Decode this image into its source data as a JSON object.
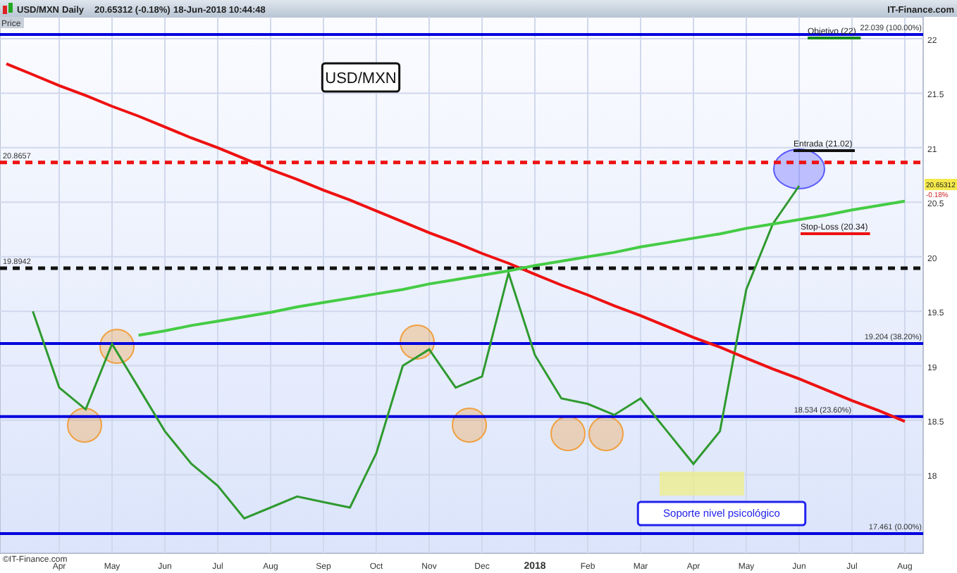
{
  "header": {
    "symbol": "USD/MXN",
    "period": "Daily",
    "quote": "20.65312 (-0.18%)",
    "timestamp": "18-Jun-2018 10:44:48",
    "brand": "IT-Finance.com"
  },
  "price_label": "Price",
  "chart": {
    "chart_data": {
      "type": "line",
      "grid": true,
      "ylim": [
        17.28,
        22.2
      ],
      "categories": [
        null,
        null,
        "Apr",
        null,
        "May",
        null,
        "Jun",
        null,
        "Jul",
        null,
        "Aug",
        null,
        "Sep",
        null,
        "Oct",
        null,
        "Nov",
        null,
        "Dec",
        null,
        "2018",
        null,
        "Feb",
        null,
        "Mar",
        null,
        "Apr",
        null,
        "May",
        null,
        "Jun",
        null,
        "Jul",
        null,
        "Aug"
      ],
      "yticks": [
        18,
        18.5,
        19,
        19.5,
        20,
        20.5,
        21,
        21.5,
        22
      ],
      "series": [
        {
          "color": "#2f9a2f",
          "values": [
            null,
            19.5,
            18.8,
            18.6,
            19.2,
            18.8,
            18.4,
            18.1,
            17.9,
            17.6,
            17.7,
            17.8,
            17.75,
            17.7,
            18.2,
            19.0,
            19.15,
            18.8,
            18.9,
            19.85,
            19.1,
            18.7,
            18.65,
            18.55,
            18.7,
            18.4,
            18.1,
            18.4,
            19.7,
            20.3,
            20.65,
            null,
            null,
            null,
            null
          ]
        },
        {
          "color": "#ee1111",
          "values": [
            21.77,
            21.67,
            21.57,
            21.48,
            21.38,
            21.29,
            21.19,
            21.09,
            21.0,
            20.9,
            20.8,
            20.71,
            20.61,
            20.52,
            20.42,
            20.32,
            20.22,
            20.13,
            20.03,
            19.94,
            19.84,
            19.74,
            19.65,
            19.55,
            19.46,
            19.36,
            19.26,
            19.17,
            19.07,
            18.97,
            18.88,
            18.78,
            18.68,
            18.59,
            18.49
          ]
        },
        {
          "color": "#44cc44",
          "values": [
            null,
            null,
            null,
            null,
            null,
            19.28,
            19.32,
            19.37,
            19.41,
            19.45,
            19.49,
            19.54,
            19.58,
            19.62,
            19.66,
            19.7,
            19.75,
            19.79,
            19.83,
            19.87,
            19.92,
            19.96,
            20.0,
            20.04,
            20.09,
            20.13,
            20.17,
            20.21,
            20.26,
            20.3,
            20.34,
            20.38,
            20.43,
            20.47,
            20.51
          ]
        }
      ],
      "ref_lines": [
        {
          "axis": "y",
          "value": 22.039,
          "label": "22.039 (100.00%)"
        },
        {
          "axis": "y",
          "value": 20.8657,
          "label": "20.8657"
        },
        {
          "axis": "y",
          "value": 19.8942,
          "label": "19.8942"
        },
        {
          "axis": "y",
          "value": 19.204,
          "label": "19.204 (38.20%)"
        },
        {
          "axis": "y",
          "value": 18.534,
          "label": "18.534 (23.60%)"
        },
        {
          "axis": "y",
          "value": 17.461,
          "label": "17.461 (0.00%)"
        }
      ],
      "annotations": [
        "Objetivo (22)",
        "Entrada (21.02)",
        "Stop-Loss (20.34)",
        "USD/MXN",
        "Soporte nivel psicológico"
      ]
    }
  },
  "last_price": {
    "value": "20.65312",
    "change": "-0.18%"
  },
  "copyright": "©IT-Finance.com"
}
